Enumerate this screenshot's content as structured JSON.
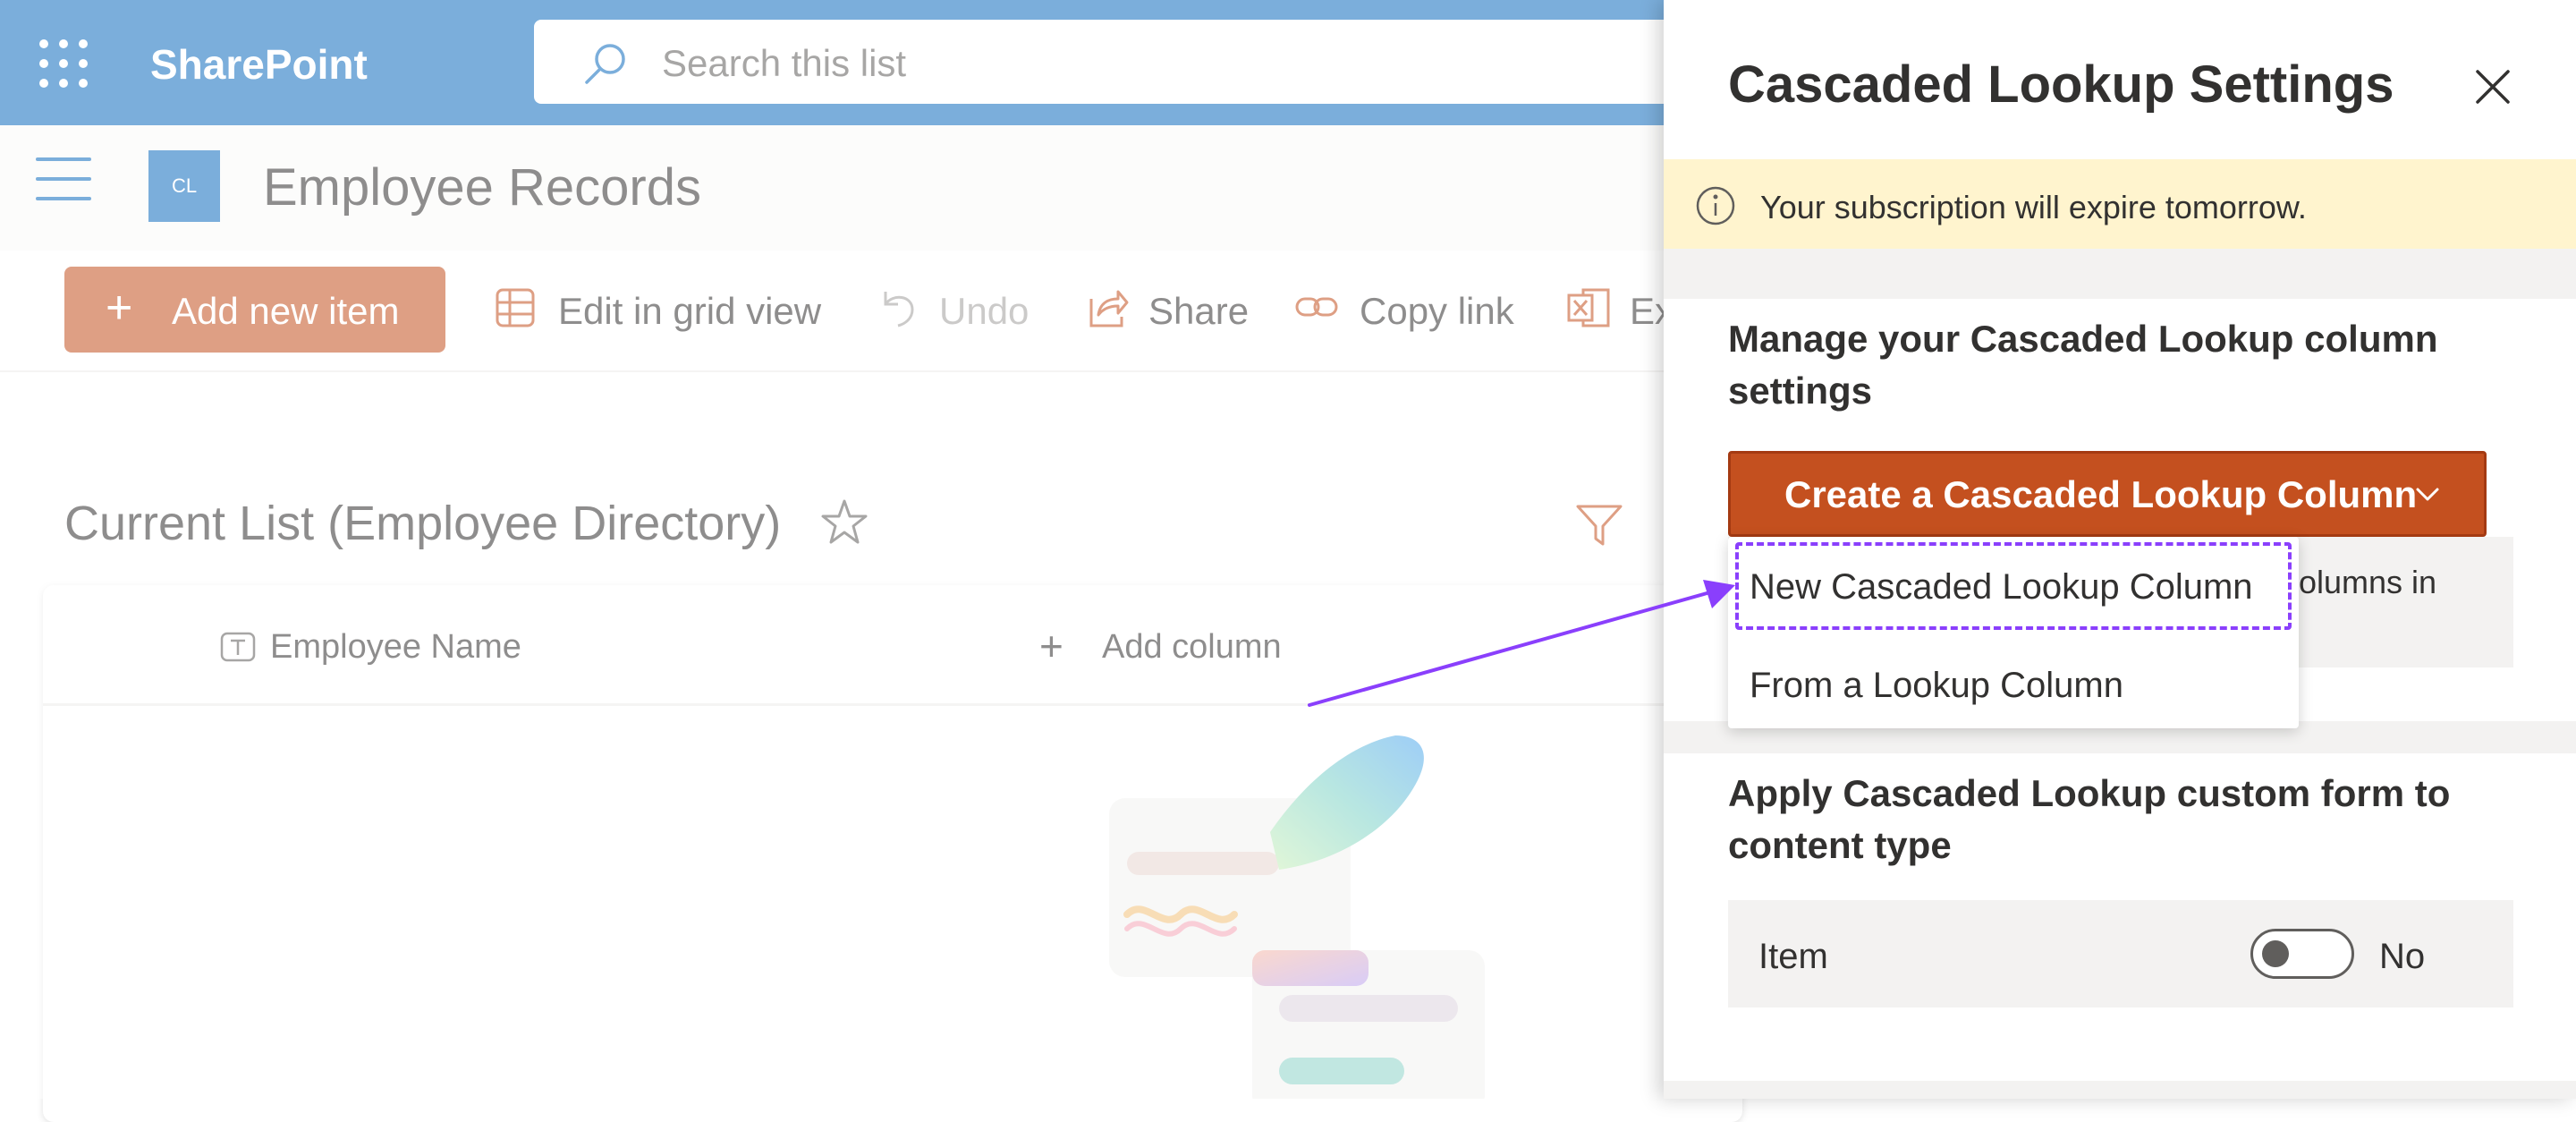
{
  "suite_bar": {
    "app_name": "SharePoint",
    "search_placeholder": "Search this list"
  },
  "site": {
    "logo_text": "CL",
    "title": "Employee Records"
  },
  "command_bar": {
    "add_new_item": "Add new item",
    "edit_grid_view": "Edit in grid view",
    "undo": "Undo",
    "share": "Share",
    "copy_link": "Copy link",
    "export_partial": "Ex"
  },
  "list": {
    "title": "Current List (Employee Directory)",
    "columns": [
      {
        "label": "Employee Name"
      },
      {
        "label": "Add column"
      }
    ]
  },
  "panel": {
    "title": "Cascaded Lookup Settings",
    "notice": "Your subscription will expire tomorrow.",
    "manage_heading": "Manage your Cascaded Lookup column settings",
    "create_button_label": "Create a Cascaded Lookup Column",
    "info_text_partial": "olumns in",
    "apply_heading": "Apply Cascaded Lookup custom form to content type",
    "content_type_row": {
      "label": "Item",
      "toggle_state": "No"
    }
  },
  "dropdown": {
    "items": [
      {
        "label": "New Cascaded Lookup Column"
      },
      {
        "label": "From a Lookup Column"
      }
    ]
  },
  "colors": {
    "brand_blue": "#0f6cbd",
    "primary_button": "#c4501f",
    "notice_bg": "#fff4ce",
    "annotation": "#8a3ffc"
  }
}
